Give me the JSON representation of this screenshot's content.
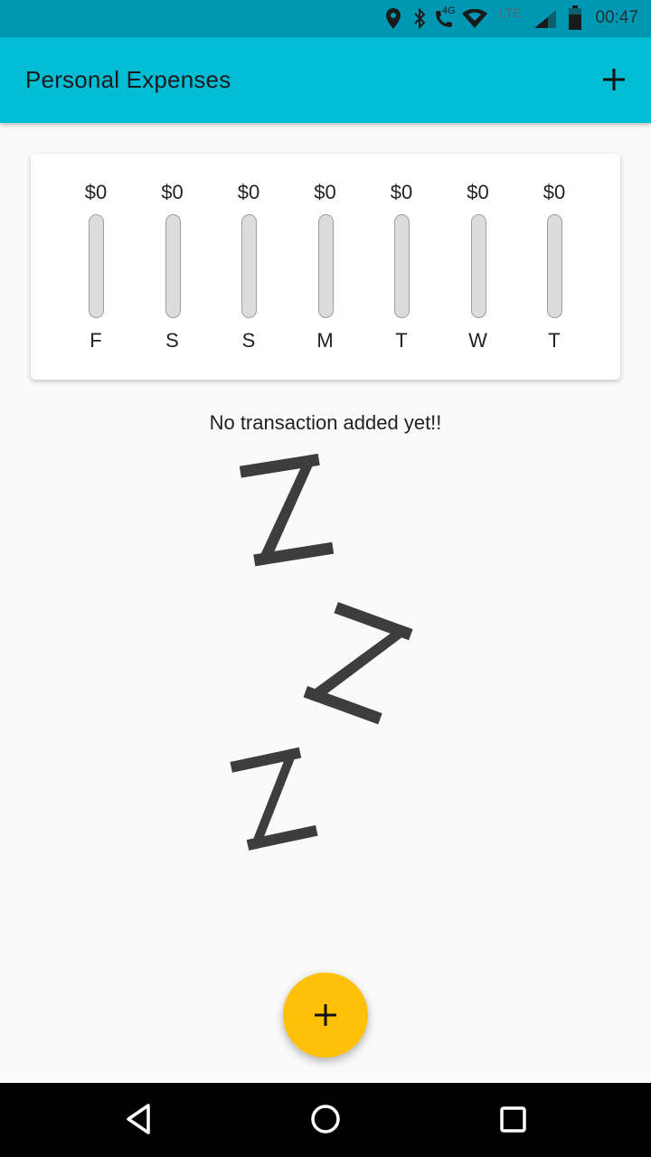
{
  "status_bar": {
    "time": "00:47",
    "network_label": "4G",
    "lte_label": "LTE",
    "icons": [
      "location-icon",
      "bluetooth-icon",
      "wifi-call-icon",
      "wifi-icon",
      "signal-icon",
      "battery-icon"
    ]
  },
  "app_bar": {
    "title": "Personal Expenses",
    "action_icon": "plus-icon"
  },
  "chart_data": {
    "type": "bar",
    "categories": [
      "F",
      "S",
      "S",
      "M",
      "T",
      "W",
      "T"
    ],
    "values": [
      0,
      0,
      0,
      0,
      0,
      0,
      0
    ],
    "value_labels": [
      "$0",
      "$0",
      "$0",
      "$0",
      "$0",
      "$0",
      "$0"
    ],
    "title": "",
    "xlabel": "",
    "ylabel": "",
    "ylim": [
      0,
      1
    ],
    "grid": false
  },
  "empty_state": {
    "message": "No transaction added yet!!",
    "image_icon": "sleep-zzz-icon"
  },
  "fab": {
    "icon": "plus-icon"
  },
  "nav_bar": {
    "icons": [
      "back-icon",
      "home-icon",
      "recents-icon"
    ]
  },
  "colors": {
    "primary": "#00bcd4",
    "status_bar": "#0097b2",
    "accent": "#ffc107",
    "bar_track": "#dcdcdc",
    "background": "#fafafa"
  }
}
